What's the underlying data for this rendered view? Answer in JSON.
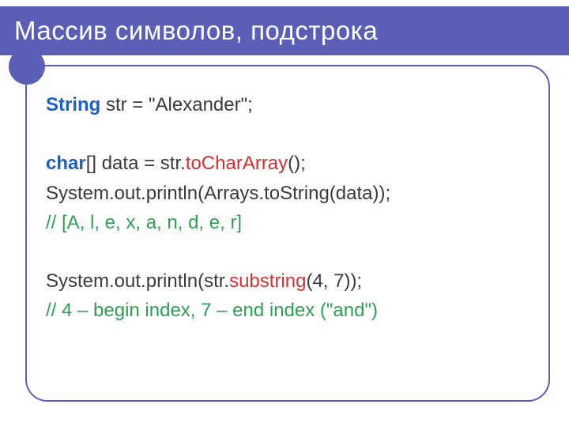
{
  "title": "Массив символов, подстрока",
  "code": {
    "l1_kw": "String",
    "l1_rest": " str = \"Alexander\";",
    "l2_kw": "char",
    "l2_a": "[] data = str.",
    "l2_call": "toCharArray",
    "l2_b": "();",
    "l3": "System.out.println(Arrays.toString(data));",
    "l4_com": "// [A, l, e, x, a, n, d, e, r]",
    "l5_a": "System.out.println(str.",
    "l5_call": "substring",
    "l5_b": "(4, 7));",
    "l6_com": "// 4 – begin index, 7 – end index (\"and\")"
  }
}
